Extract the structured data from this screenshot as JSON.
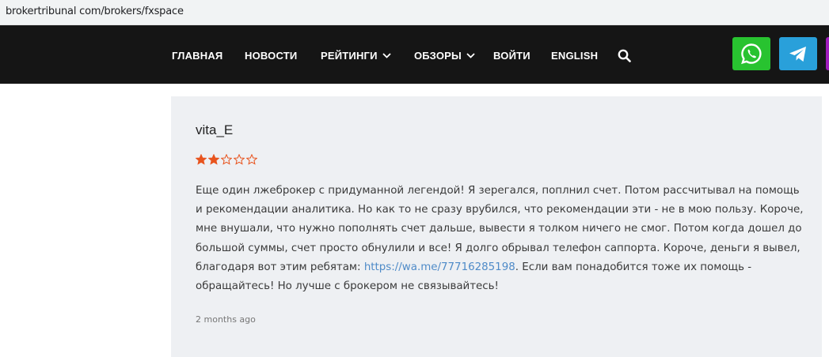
{
  "browser": {
    "url": "brokertribunal com/brokers/fxspace"
  },
  "nav": {
    "items": [
      {
        "label": "ГЛАВНАЯ"
      },
      {
        "label": "НОВОСТИ"
      },
      {
        "label": "РЕЙТИНГИ"
      },
      {
        "label": "ОБЗОРЫ"
      },
      {
        "label": "ВОЙТИ"
      },
      {
        "label": "ENGLISH"
      }
    ],
    "search_icon": "search-icon",
    "social": [
      {
        "icon": "whatsapp-icon",
        "color": "#28c330"
      },
      {
        "icon": "telegram-icon",
        "color": "#29a0da"
      },
      {
        "icon": "viber-icon",
        "color": "#a01dbd"
      }
    ]
  },
  "review": {
    "author": "vita_E",
    "rating": 2,
    "max_rating": 5,
    "star_color": "#e8541e",
    "text_before_link": "Еще один лжеброкер с придуманной легендой! Я зерегался, поплнил счет. Потом рассчитывал на помощь и рекомендации аналитика. Но как то не сразу врубился, что рекомендации эти - не в мою пользу. Короче, мне внушали, что нужно пополнять счет дальше, вывести я толком ничего не смог. Потом когда дошел до большой суммы, счет просто обнулили и все! Я долго обрывал телефон саппорта. Короче, деньги я вывел, благодаря вот этим ребятам: ",
    "link_text": "https://wa.me/77716285198",
    "text_after_link": ". Если вам понадобится тоже их помощь - обращайтесь! Но лучше с брокером не связывайтесь!",
    "timestamp": "2 months ago"
  }
}
